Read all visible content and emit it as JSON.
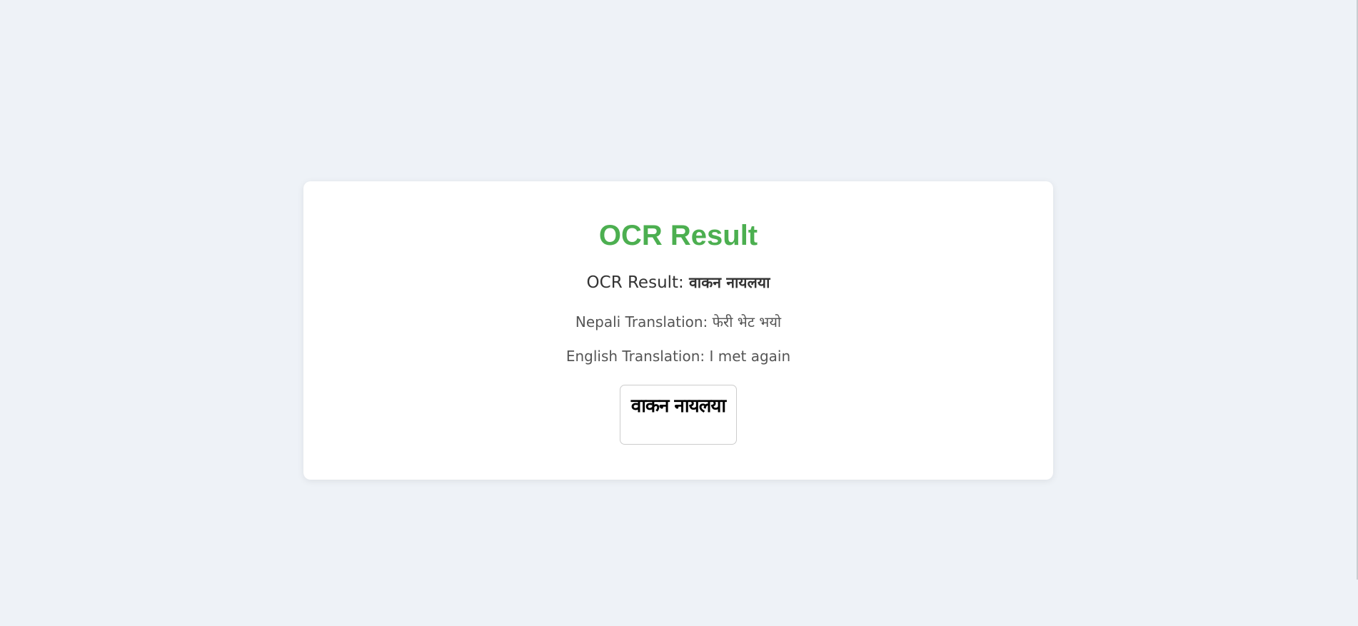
{
  "card": {
    "title": "OCR Result",
    "ocr_label": "OCR Result: ",
    "ocr_value": "वाकन नायलया",
    "nepali_label": "Nepali Translation: ",
    "nepali_value": "फेरी भेट भयो",
    "english_label": "English Translation: ",
    "english_value": "I met again",
    "image_text": "वाकन नायलया"
  },
  "colors": {
    "title": "#4caf50",
    "background": "#eef2f7",
    "card": "#ffffff"
  }
}
